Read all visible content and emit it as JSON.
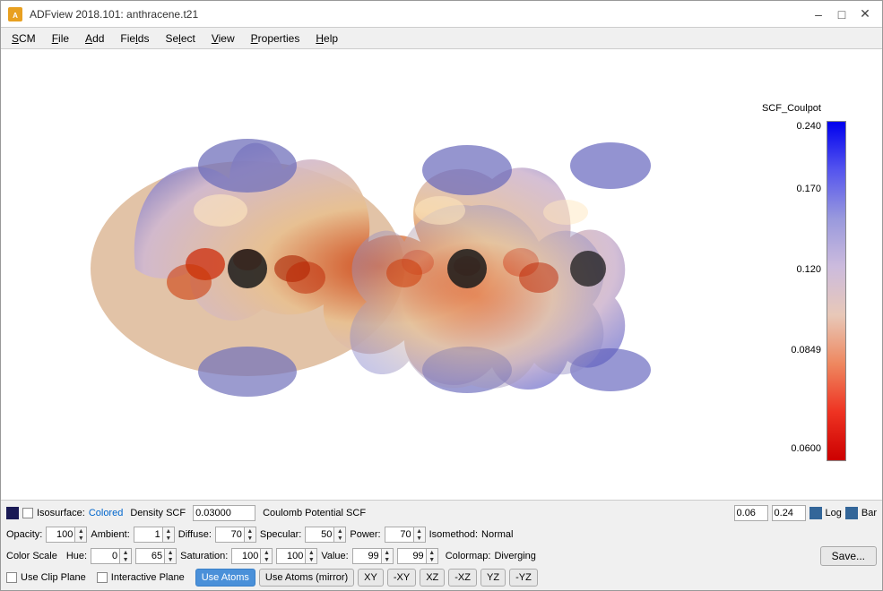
{
  "window": {
    "title": "ADFview 2018.101: anthracene.t21",
    "icon_label": "ADF"
  },
  "titlebar": {
    "minimize_label": "–",
    "maximize_label": "□",
    "close_label": "✕"
  },
  "menu": {
    "items": [
      {
        "id": "scm",
        "label": "SCM",
        "underline_index": 0
      },
      {
        "id": "file",
        "label": "File",
        "underline_index": 0
      },
      {
        "id": "add",
        "label": "Add",
        "underline_index": 0
      },
      {
        "id": "fields",
        "label": "Fields",
        "underline_index": 0
      },
      {
        "id": "select",
        "label": "Select",
        "underline_index": 0
      },
      {
        "id": "view",
        "label": "View",
        "underline_index": 0
      },
      {
        "id": "properties",
        "label": "Properties",
        "underline_index": 0
      },
      {
        "id": "help",
        "label": "Help",
        "underline_index": 0
      }
    ]
  },
  "colorscale": {
    "title": "SCF_Coulpot",
    "max_label": "0.240",
    "val1_label": "0.170",
    "val2_label": "0.120",
    "val3_label": "0.0849",
    "min_label": "0.0600"
  },
  "controls": {
    "row1": {
      "isosurface_label": "Isosurface:",
      "isosurface_type": "Colored",
      "density_label": "Density SCF",
      "iso_value": "0.03000",
      "potential_label": "Coulomb Potential SCF",
      "min_val": "0.06",
      "max_val": "0.24",
      "log_label": "Log",
      "bar_label": "Bar"
    },
    "row2": {
      "opacity_label": "Opacity:",
      "opacity_val": "100",
      "ambient_label": "Ambient:",
      "ambient_val": "1",
      "diffuse_label": "Diffuse:",
      "diffuse_val": "70",
      "specular_label": "Specular:",
      "specular_val": "50",
      "power_label": "Power:",
      "power_val": "70",
      "isomethod_label": "Isomethod:",
      "isomethod_val": "Normal"
    },
    "row3": {
      "colorscale_label": "Color Scale",
      "hue_label": "Hue:",
      "hue_val1": "0",
      "hue_val2": "65",
      "saturation_label": "Saturation:",
      "sat_val1": "100",
      "sat_val2": "100",
      "value_label": "Value:",
      "value_val1": "99",
      "value_val2": "99",
      "colormap_label": "Colormap:",
      "colormap_val": "Diverging",
      "save_label": "Save..."
    },
    "row4": {
      "clip_plane_label": "Use Clip Plane",
      "interactive_plane_label": "Interactive Plane",
      "use_atoms_label": "Use Atoms",
      "use_atoms_mirror_label": "Use Atoms (mirror)",
      "btn_xy": "XY",
      "btn_neg_xy": "-XY",
      "btn_xz": "XZ",
      "btn_neg_xz": "-XZ",
      "btn_yz": "YZ",
      "btn_neg_yz": "-YZ"
    }
  }
}
